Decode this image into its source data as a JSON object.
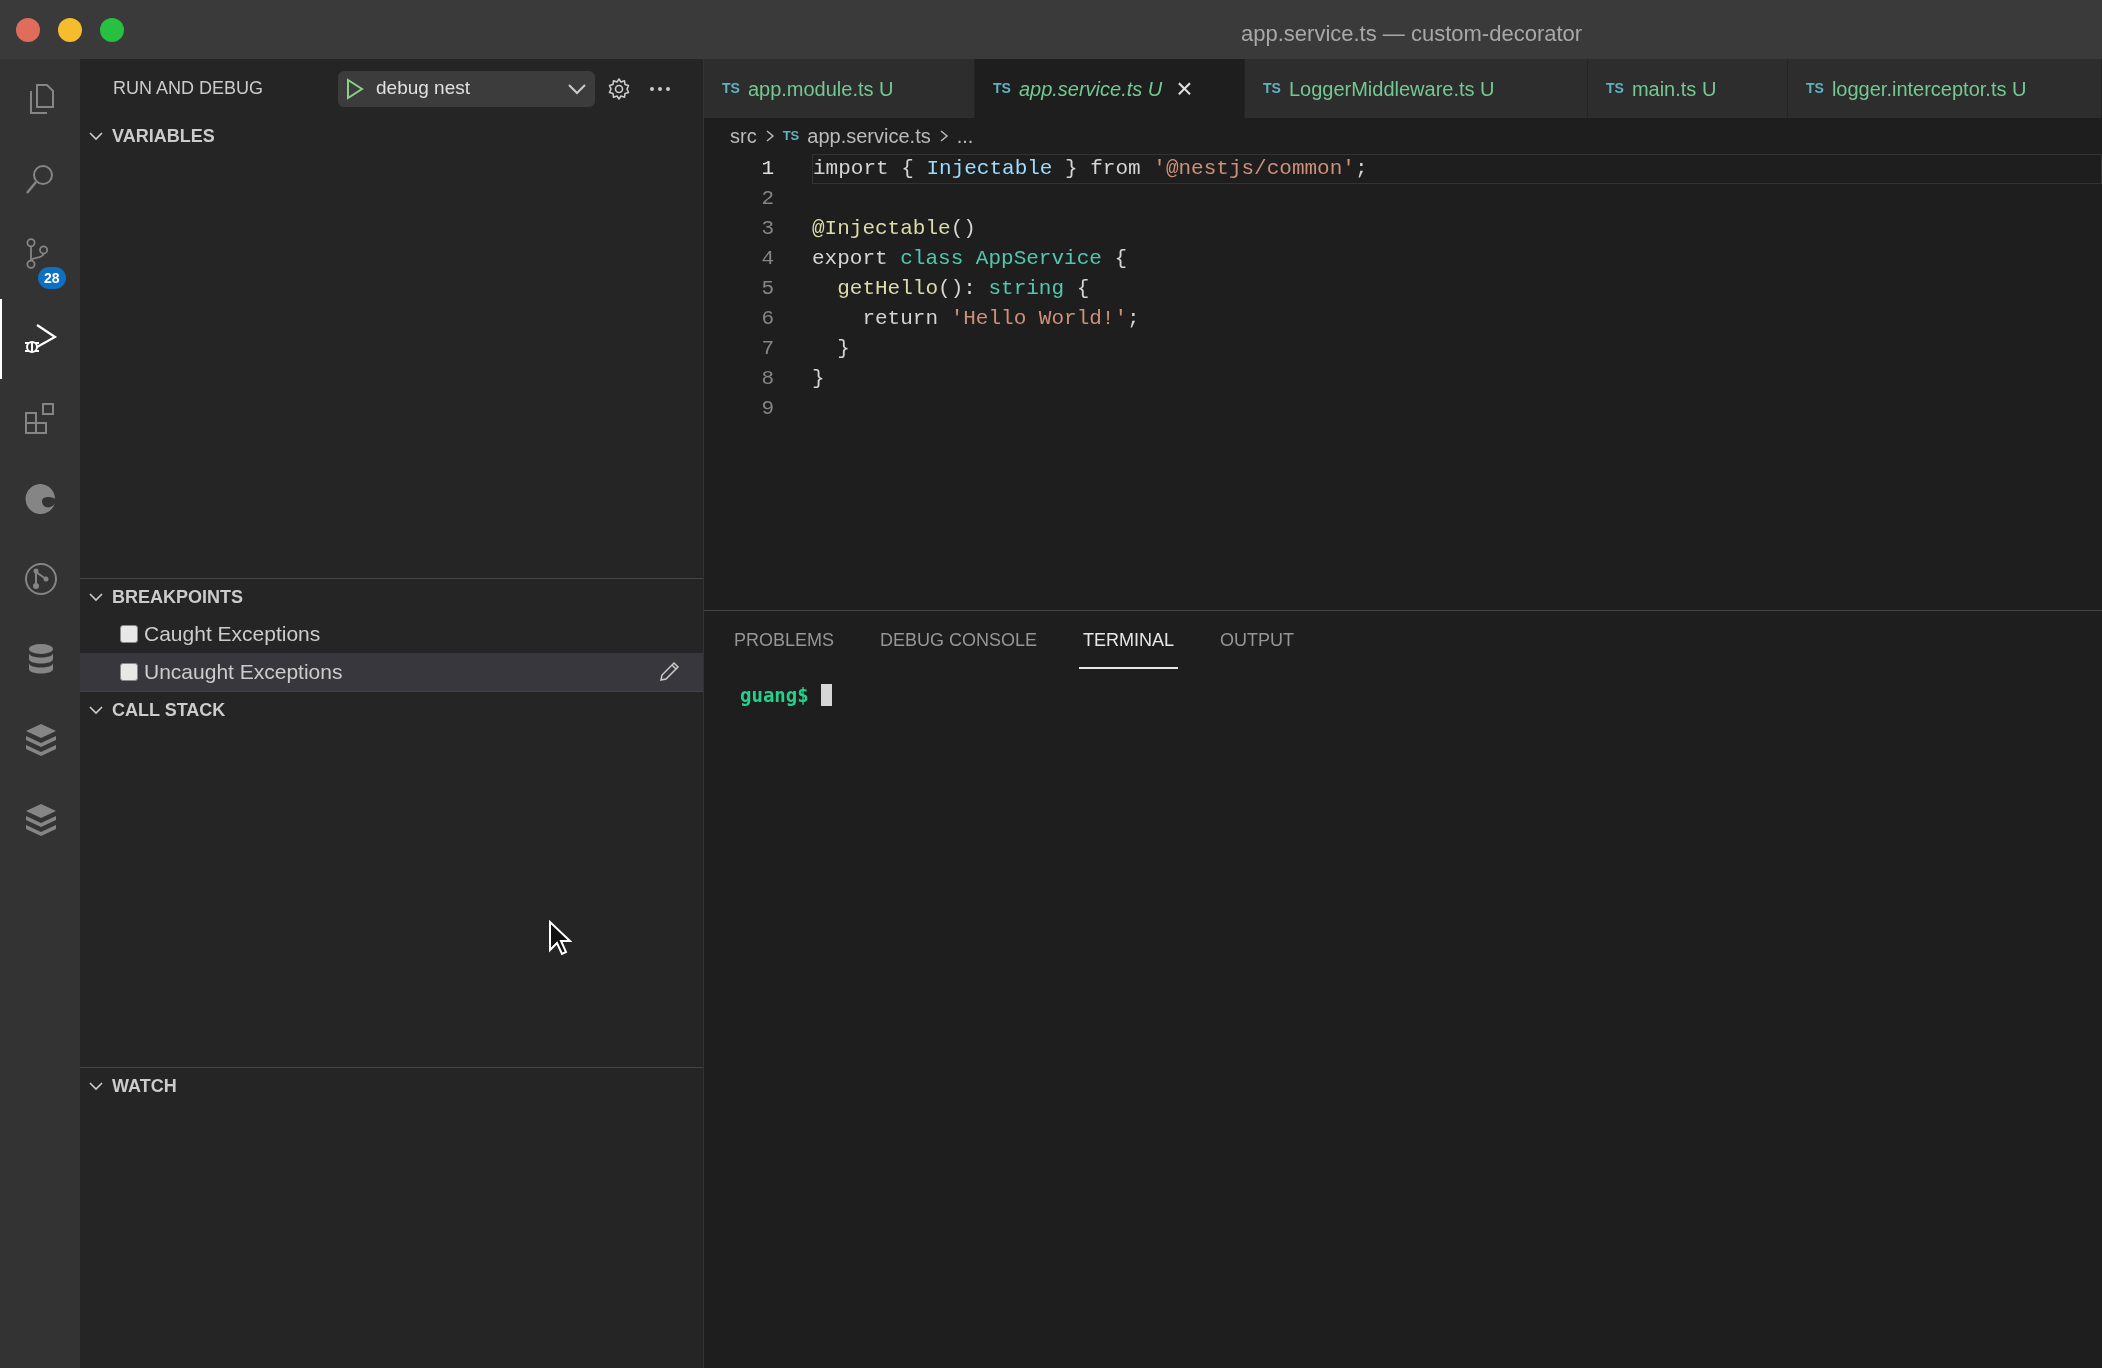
{
  "window": {
    "title": "app.service.ts — custom-decorator"
  },
  "activity_bar": [
    {
      "kind": "files",
      "selected": false
    },
    {
      "kind": "search",
      "selected": false
    },
    {
      "kind": "source-control",
      "selected": false,
      "badge": "28"
    },
    {
      "kind": "run-debug",
      "selected": true
    },
    {
      "kind": "extensions",
      "selected": false
    },
    {
      "kind": "swirl",
      "selected": false
    },
    {
      "kind": "branch-circle",
      "selected": false
    },
    {
      "kind": "database",
      "selected": false
    },
    {
      "kind": "stack",
      "selected": false
    },
    {
      "kind": "stack",
      "selected": false
    }
  ],
  "sidebar": {
    "title": "RUN AND DEBUG",
    "launch_config": "debug nest",
    "sections": [
      {
        "title": "VARIABLES",
        "expanded": true
      },
      {
        "title": "BREAKPOINTS",
        "expanded": true,
        "items": [
          {
            "label": "Caught Exceptions",
            "checked": false,
            "selected": false
          },
          {
            "label": "Uncaught Exceptions",
            "checked": false,
            "selected": true
          }
        ]
      },
      {
        "title": "CALL STACK",
        "expanded": true
      },
      {
        "title": "WATCH",
        "expanded": true
      }
    ]
  },
  "tabs": [
    {
      "icon": "TS",
      "label": "app.module.ts",
      "status": "U",
      "selected": false,
      "preview": false
    },
    {
      "icon": "TS",
      "label": "app.service.ts",
      "status": "U",
      "selected": true,
      "preview": true
    },
    {
      "icon": "TS",
      "label": "LoggerMiddleware.ts",
      "status": "U",
      "selected": false,
      "preview": false
    },
    {
      "icon": "TS",
      "label": "main.ts",
      "status": "U",
      "selected": false,
      "preview": false
    },
    {
      "icon": "TS",
      "label": "logger.interceptor.ts",
      "status": "U",
      "selected": false,
      "preview": false
    }
  ],
  "close_symbol": "×",
  "breadcrumb": [
    {
      "label": "src"
    },
    {
      "icon": "TS",
      "label": "app.service.ts"
    },
    {
      "label": "..."
    }
  ],
  "editor": {
    "lines": [
      {
        "number": "1",
        "current": true,
        "tokens": [
          {
            "text": "import { ",
            "kind": "plain"
          },
          {
            "text": "Injectable",
            "kind": "var"
          },
          {
            "text": " } from ",
            "kind": "plain"
          },
          {
            "text": "'@nestjs/common'",
            "kind": "string"
          },
          {
            "text": ";",
            "kind": "plain"
          }
        ]
      },
      {
        "number": "2",
        "current": false
      },
      {
        "number": "3",
        "current": false,
        "tokens": [
          {
            "text": "@Injectable",
            "kind": "func"
          },
          {
            "text": "()",
            "kind": "plain"
          }
        ]
      },
      {
        "number": "4",
        "current": false,
        "tokens": [
          {
            "text": "export ",
            "kind": "plain"
          },
          {
            "text": "class ",
            "kind": "keyword"
          },
          {
            "text": "AppService",
            "kind": "type"
          },
          {
            "text": " {",
            "kind": "plain"
          }
        ]
      },
      {
        "number": "5",
        "current": false,
        "tokens": [
          {
            "text": "  getHello",
            "kind": "func"
          },
          {
            "text": "(): ",
            "kind": "plain"
          },
          {
            "text": "string",
            "kind": "type"
          },
          {
            "text": " {",
            "kind": "plain"
          }
        ]
      },
      {
        "number": "6",
        "current": false,
        "tokens": [
          {
            "text": "    return ",
            "kind": "plain"
          },
          {
            "text": "'Hello World!'",
            "kind": "string"
          },
          {
            "text": ";",
            "kind": "plain"
          }
        ]
      },
      {
        "number": "7",
        "current": false,
        "tokens": [
          {
            "text": "  }",
            "kind": "plain"
          }
        ]
      },
      {
        "number": "8",
        "current": false,
        "tokens": [
          {
            "text": "}",
            "kind": "plain"
          }
        ]
      },
      {
        "number": "9",
        "current": false
      }
    ]
  },
  "panel": {
    "tabs": [
      {
        "label": "PROBLEMS",
        "selected": false
      },
      {
        "label": "DEBUG CONSOLE",
        "selected": false
      },
      {
        "label": "TERMINAL",
        "selected": true
      },
      {
        "label": "OUTPUT",
        "selected": false
      }
    ],
    "terminal": {
      "prompt": "guang$"
    }
  }
}
